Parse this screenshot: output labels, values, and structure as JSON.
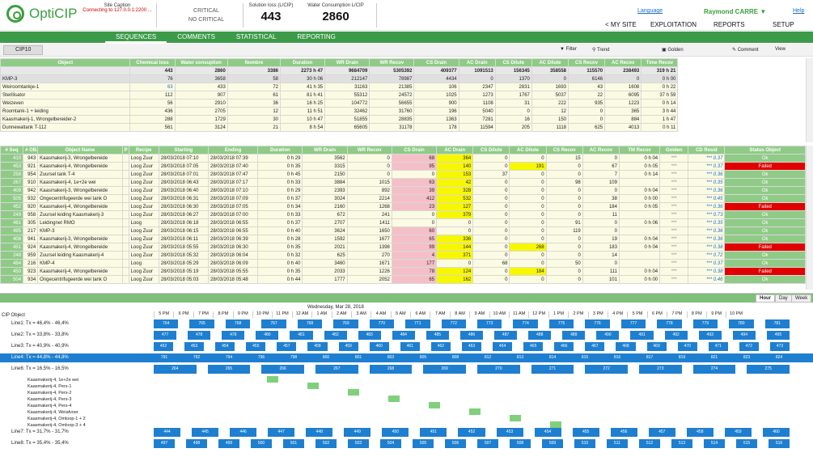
{
  "app": {
    "logo": "OptiCIP",
    "site_caption": "Site Caption",
    "connecting": "Connecting to 127.0.0.1:2200 ...",
    "crit1": "CRITICAL",
    "crit2": "NO CRITICAL",
    "kpi1_title": "Solution loss (L/CIP)",
    "kpi1_value": "443",
    "kpi2_title": "Water Consumption L/CIP",
    "kpi2_value": "2860"
  },
  "nav": {
    "language": "Language",
    "user": "Raymond CARRE",
    "help": "Help",
    "mysite": "< MY SITE",
    "exploitation": "EXPLOITATION",
    "reports": "REPORTS",
    "setup": "SETUP"
  },
  "tabs": [
    "SEQUENCES",
    "COMMENTS",
    "STATISTICAL",
    "REPORTING"
  ],
  "toolbar": {
    "cip": "CIP10",
    "filter": "Filter",
    "trend": "Trend",
    "golden": "Golden",
    "comment": "Comment",
    "view": "View"
  },
  "summary": {
    "headers": [
      "Object",
      "Chemical loss",
      "Water consuption",
      "Nombre",
      "Duration",
      "WR Drain",
      "WR Recov",
      "CS Drain",
      "AC Drain",
      "CS Dilute",
      "AC Dilute",
      "CS Recov",
      "AC Recov",
      "Time Recov"
    ],
    "totals": [
      "",
      "443",
      "2860",
      "3386",
      "2273 h 47",
      "9684709",
      "5305392",
      "409377",
      "1091513",
      "156345",
      "358558",
      "115570",
      "238493",
      "319 h 21"
    ],
    "rows": [
      [
        "KMP-3",
        "76",
        "3658",
        "58",
        "30 h 06",
        "212147",
        "78987",
        "4434",
        "0",
        "1370",
        "0",
        "6146",
        "0",
        "0 h 00"
      ],
      [
        "Weiroomtankje-1",
        "63",
        "433",
        "72",
        "41 h 35",
        "31163",
        "21385",
        "106",
        "2347",
        "2831",
        "1693",
        "43",
        "1608",
        "0 h 22"
      ],
      [
        "Sterilisator",
        "112",
        "907",
        "61",
        "81 h 41",
        "55312",
        "24572",
        "1025",
        "1273",
        "1767",
        "5037",
        "22",
        "6095",
        "37 h 59"
      ],
      [
        "Weizeven",
        "56",
        "2910",
        "36",
        "16 h 25",
        "104772",
        "56655",
        "900",
        "1108",
        "31",
        "222",
        "935",
        "1223",
        "0 h 14"
      ],
      [
        "Roomtank-1 + leiding",
        "436",
        "2705",
        "12",
        "11 h 51",
        "32462",
        "31760",
        "196",
        "5040",
        "0",
        "12",
        "0",
        "365",
        "3 h 44"
      ],
      [
        "Kaasmakerij-1, Wrongelbereider-2",
        "288",
        "1729",
        "30",
        "10 h 47",
        "51855",
        "28835",
        "1363",
        "7281",
        "16",
        "150",
        "0",
        "884",
        "1 h 47"
      ],
      [
        "Dunnewaltank T-112",
        "561",
        "3124",
        "21",
        "8 h 54",
        "65605",
        "31178",
        "178",
        "11594",
        "205",
        "1118",
        "625",
        "4013",
        "0 h 11"
      ]
    ]
  },
  "detail": {
    "headers": [
      "# Seq",
      "# OB...",
      "Object Name",
      "P",
      "Recipe",
      "Starting",
      "Ending",
      "Duration",
      "WR Drain",
      "WR Recov",
      "CS Drain",
      "AC Drain",
      "CS Dilute",
      "AC Dilute",
      "CS Recov",
      "AC Recov",
      "TM Recov",
      "Golden",
      "CD Resid",
      "Status Object"
    ],
    "rows": [
      [
        "410",
        "943",
        "Kaasmakerij-3, Wrongelbereide",
        "",
        "Loog Zuur",
        "28/03/2018 07:10",
        "28/03/2018 07:39",
        "0 h 29",
        "3562",
        "0",
        "68",
        "364",
        "0",
        "0",
        "15",
        "0",
        "0 h 04",
        "***",
        "*** 0.37",
        "Ok"
      ],
      [
        "453",
        "921",
        "Kaasmakerij-4, Wrongelbereide",
        "",
        "Loog Zuur",
        "28/03/2018 07:05",
        "28/03/2018 07:40",
        "0 h 35",
        "3315",
        "0",
        "95",
        "140",
        "0",
        "191",
        "0",
        "67",
        "0 h 05",
        "***",
        "*** 0.37",
        "Failed"
      ],
      [
        "258",
        "954",
        "Zuursel tank T-4",
        "",
        "Loog Zuur",
        "28/03/2018 07:01",
        "28/03/2018 07:47",
        "0 h 45",
        "2150",
        "0",
        "0",
        "153",
        "37",
        "0",
        "0",
        "7",
        "0 h 14",
        "***",
        "*** 0.36",
        "Ok"
      ],
      [
        "267",
        "910",
        "Kaasmakerij-4, 1e+2e wei",
        "",
        "Loog Zuur",
        "28/03/2018 06:43",
        "28/03/2018 07:17",
        "0 h 33",
        "3884",
        "1015",
        "63",
        "42",
        "0",
        "0",
        "98",
        "109",
        "",
        "***",
        "*** 0.35",
        "Ok"
      ],
      [
        "409",
        "942",
        "Kaasmakerij-3, Wrongelbereide",
        "",
        "Loog Zuur",
        "28/03/2018 06:40",
        "28/03/2018 07:10",
        "0 h 29",
        "2393",
        "892",
        "39",
        "328",
        "0",
        "0",
        "0",
        "0",
        "0 h 04",
        "***",
        "*** 0.36",
        "Ok"
      ],
      [
        "505",
        "932",
        "Ongecentrifugeerde wei tank O",
        "",
        "Loog Zuur",
        "28/03/2018 06:31",
        "28/03/2018 07:09",
        "0 h 37",
        "3024",
        "2214",
        "412",
        "532",
        "0",
        "0",
        "0",
        "38",
        "0 h 00",
        "***",
        "*** 0.45",
        "Ok"
      ],
      [
        "452",
        "920",
        "Kaasmakerij-4, Wrongelbereide",
        "",
        "Loog Zuur",
        "28/03/2018 06:30",
        "28/03/2018 07:05",
        "0 h 34",
        "2160",
        "1268",
        "23",
        "127",
        "0",
        "0",
        "0",
        "184",
        "0 h 05",
        "***",
        "*** 0.36",
        "Failed"
      ],
      [
        "249",
        "958",
        "Zuursel leiding Kaasmakerij-3",
        "",
        "Loog Zuur",
        "28/03/2018 06:27",
        "28/03/2018 07:00",
        "0 h 33",
        "672",
        "241",
        "0",
        "379",
        "0",
        "0",
        "0",
        "11",
        "",
        "***",
        "*** 0.73",
        "Ok"
      ],
      [
        "461",
        "305",
        "Leidingnet RMO",
        "",
        "Loog",
        "28/03/2018 06:18",
        "28/03/2018 06:55",
        "0 h 37",
        "2707",
        "1411",
        "0",
        "0",
        "0",
        "0",
        "91",
        "0",
        "0 h 06",
        "***",
        "*** 0.35",
        "Ok"
      ],
      [
        "495",
        "217",
        "KMP-3",
        "",
        "Loog Zuur",
        "28/03/2018 06:15",
        "28/03/2018 06:55",
        "0 h 40",
        "3624",
        "1650",
        "60",
        "0",
        "0",
        "0",
        "119",
        "0",
        "",
        "***",
        "*** 0.36",
        "Ok"
      ],
      [
        "408",
        "941",
        "Kaasmakerij-3, Wrongelbereide",
        "",
        "Loog Zuur",
        "28/03/2018 06:11",
        "28/03/2018 06:39",
        "0 h 28",
        "1592",
        "1677",
        "65",
        "336",
        "0",
        "0",
        "0",
        "19",
        "0 h 04",
        "***",
        "*** 0.36",
        "Ok"
      ],
      [
        "451",
        "924",
        "Kaasmakerij-4, Wrongelbereide",
        "",
        "Loog Zuur",
        "28/03/2018 05:55",
        "28/03/2018 06:30",
        "0 h 35",
        "2021",
        "1398",
        "99",
        "144",
        "0",
        "268",
        "0",
        "183",
        "0 h 04",
        "***",
        "*** 0.38",
        "Failed"
      ],
      [
        "248",
        "959",
        "Zuursel leiding Kaasmakerij-4",
        "",
        "Loog Zuur",
        "28/03/2018 05:32",
        "28/03/2018 06:04",
        "0 h 32",
        "625",
        "270",
        "4",
        "371",
        "0",
        "0",
        "0",
        "14",
        "",
        "***",
        "*** 0.72",
        "Ok"
      ],
      [
        "484",
        "216",
        "KMP-4",
        "",
        "Loog",
        "28/03/2018 05:29",
        "28/03/2018 06:09",
        "0 h 40",
        "3460",
        "1671",
        "177",
        "0",
        "68",
        "0",
        "50",
        "0",
        "",
        "***",
        "*** 0.37",
        "Ok"
      ],
      [
        "450",
        "923",
        "Kaasmakerij-4, Wrongelbereide",
        "",
        "Loog Zuur",
        "28/03/2018 05:19",
        "28/03/2018 05:55",
        "0 h 35",
        "2033",
        "1226",
        "78",
        "124",
        "0",
        "184",
        "0",
        "111",
        "0 h 04",
        "***",
        "*** 0.38",
        "Failed"
      ],
      [
        "504",
        "934",
        "Ongecentrifugeerde wei tank O",
        "",
        "Loog Zuur",
        "28/03/2018 05:03",
        "28/03/2018 05:48",
        "0 h 44",
        "1777",
        "2052",
        "65",
        "162",
        "0",
        "0",
        "0",
        "101",
        "0 h 00",
        "***",
        "*** 0.46",
        "Ok"
      ]
    ]
  },
  "gantt": {
    "tabs": [
      "Hour",
      "Day",
      "Week"
    ],
    "date": "Wednesday, Mar 28, 2018",
    "cip_object": "CIP Object",
    "hours": [
      "5 PM",
      "6 PM",
      "7 PM",
      "8 PM",
      "9 PM",
      "10 PM",
      "11 PM",
      "12 AM",
      "1 AM",
      "2 AM",
      "3 AM",
      "4 AM",
      "5 AM",
      "6 AM",
      "7 AM",
      "8 AM",
      "9 AM",
      "10 AM",
      "11 AM",
      "12 PM",
      "1 PM",
      "2 PM",
      "3 PM",
      "4 PM",
      "5 PM",
      "6 PM",
      "7 PM",
      "8 PM",
      "9 PM",
      "10 PM"
    ],
    "lines": [
      "Line1:  Tx = 46,4% - 46,4%",
      "Line2:  Tx = 33,8% - 33,8%",
      "Line3:  Tx = 40,9% - 40,9%",
      "Line4:  Tx = 44,8% - 44,8%",
      "Line6:  Tx = 16,5% - 16,5%"
    ],
    "sublines": [
      "Kaasmakerij-4, 1e+2e wei",
      "Kaasmakerij-4, Pers-1",
      "Kaasmakerij-4, Pers-2",
      "Kaasmakerij-4, Pers-3",
      "Kaasmakerij-4, Pers-4",
      "Kaasmakerij-4, Weiafvoer",
      "Kaasmakerij-4, Omloop-1 + 2",
      "Kaasmakerij-4, Omloop-3 + 4"
    ],
    "lines2": [
      "Line7:  Tx = 31,7% - 31,7%",
      "Line8:  Tx = 35,4% - 35,4%"
    ],
    "line1_segs": [
      "764",
      "765",
      "768",
      "767",
      "768",
      "769",
      "770",
      "771",
      "772",
      "773",
      "774",
      "775",
      "776",
      "777",
      "778",
      "779",
      "780",
      "781"
    ],
    "line2_segs": [
      "477",
      "478",
      "479",
      "480",
      "481",
      "482",
      "483",
      "484",
      "485",
      "486",
      "487",
      "488",
      "489",
      "490",
      "491",
      "492",
      "493",
      "494",
      "495"
    ],
    "line3_segs": [
      "452",
      "453",
      "454",
      "455",
      "457",
      "458",
      "459",
      "460",
      "461",
      "462",
      "463",
      "464",
      "465",
      "466",
      "467",
      "468",
      "469",
      "470",
      "471",
      "472",
      "473"
    ],
    "line4_segs": [
      "791",
      "792",
      "794",
      "796",
      "798",
      "800",
      "801",
      "803",
      "805",
      "808",
      "812",
      "813",
      "814",
      "815",
      "816",
      "817",
      "819",
      "821",
      "823",
      "824"
    ],
    "line6_segs": [
      "264",
      "265",
      "266",
      "267",
      "268",
      "269",
      "270",
      "271",
      "272",
      "273",
      "274",
      "275"
    ],
    "line7_segs": [
      "444",
      "445",
      "446",
      "447",
      "448",
      "449",
      "450",
      "451",
      "452",
      "453",
      "454",
      "455",
      "456",
      "457",
      "458",
      "459",
      "460"
    ],
    "line8_segs": [
      "497",
      "498",
      "499",
      "500",
      "501",
      "502",
      "503",
      "504",
      "505",
      "506",
      "507",
      "508",
      "509",
      "510",
      "511",
      "512",
      "513",
      "514",
      "515",
      "516"
    ]
  }
}
